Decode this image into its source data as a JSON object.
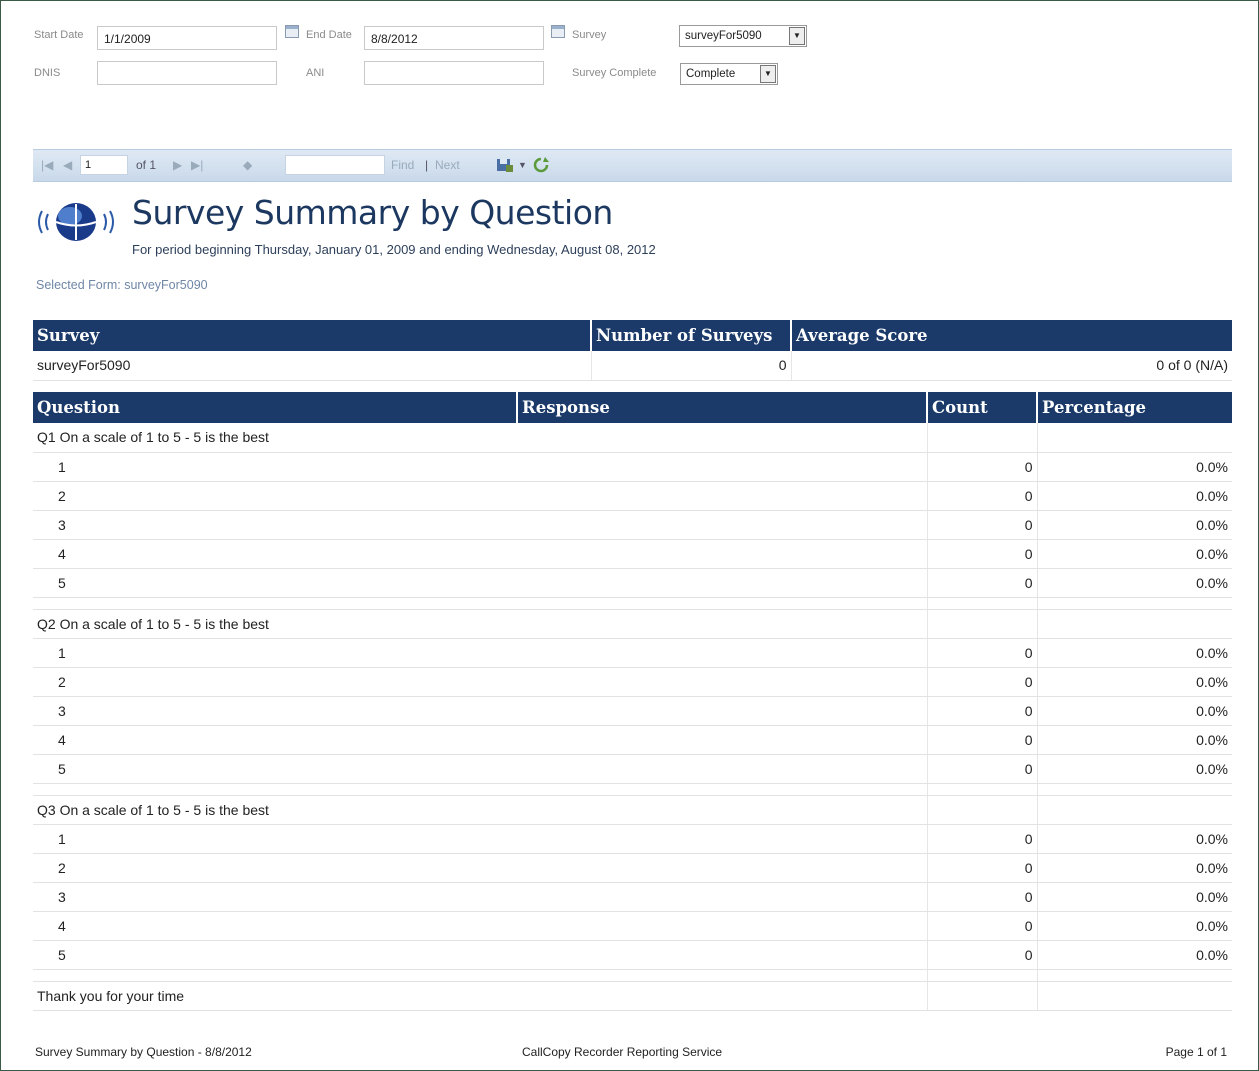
{
  "params": {
    "start_date_label": "Start Date",
    "start_date_value": "1/1/2009",
    "end_date_label": "End Date",
    "end_date_value": "8/8/2012",
    "survey_label": "Survey",
    "survey_value": "surveyFor5090",
    "dnis_label": "DNIS",
    "dnis_value": "",
    "ani_label": "ANI",
    "ani_value": "",
    "survey_complete_label": "Survey Complete",
    "survey_complete_value": "Complete"
  },
  "toolbar": {
    "page_value": "1",
    "of_label": "of 1",
    "find_label": "Find",
    "separator": "|",
    "next_label": "Next",
    "search_value": ""
  },
  "report": {
    "title": "Survey Summary by Question",
    "period": "For period beginning Thursday, January 01, 2009 and ending Wednesday, August 08, 2012",
    "selected_form": "Selected Form: surveyFor5090"
  },
  "summary_table": {
    "headers": [
      "Survey",
      "Number of Surveys",
      "Average Score"
    ],
    "row": [
      "surveyFor5090",
      "0",
      "0 of 0 (N/A)"
    ]
  },
  "question_table": {
    "headers": [
      "Question",
      "Response",
      "Count",
      "Percentage"
    ],
    "questions": [
      {
        "text": "Q1 On a scale of 1 to 5 - 5 is the best",
        "responses": [
          {
            "label": "1",
            "count": "0",
            "pct": "0.0%"
          },
          {
            "label": "2",
            "count": "0",
            "pct": "0.0%"
          },
          {
            "label": "3",
            "count": "0",
            "pct": "0.0%"
          },
          {
            "label": "4",
            "count": "0",
            "pct": "0.0%"
          },
          {
            "label": "5",
            "count": "0",
            "pct": "0.0%"
          }
        ]
      },
      {
        "text": "Q2 On a scale of 1 to 5 - 5 is the best",
        "responses": [
          {
            "label": "1",
            "count": "0",
            "pct": "0.0%"
          },
          {
            "label": "2",
            "count": "0",
            "pct": "0.0%"
          },
          {
            "label": "3",
            "count": "0",
            "pct": "0.0%"
          },
          {
            "label": "4",
            "count": "0",
            "pct": "0.0%"
          },
          {
            "label": "5",
            "count": "0",
            "pct": "0.0%"
          }
        ]
      },
      {
        "text": "Q3 On a scale of 1 to 5 - 5 is the best",
        "responses": [
          {
            "label": "1",
            "count": "0",
            "pct": "0.0%"
          },
          {
            "label": "2",
            "count": "0",
            "pct": "0.0%"
          },
          {
            "label": "3",
            "count": "0",
            "pct": "0.0%"
          },
          {
            "label": "4",
            "count": "0",
            "pct": "0.0%"
          },
          {
            "label": "5",
            "count": "0",
            "pct": "0.0%"
          }
        ]
      }
    ],
    "closing_text": "Thank you for your time"
  },
  "footer": {
    "left": "Survey Summary by Question - 8/8/2012",
    "center": "CallCopy Recorder Reporting Service",
    "right": "Page 1 of 1"
  },
  "colors": {
    "header_bg": "#1b3a6a",
    "toolbar_bg": "#d4e1ef",
    "title": "#1c3860"
  }
}
